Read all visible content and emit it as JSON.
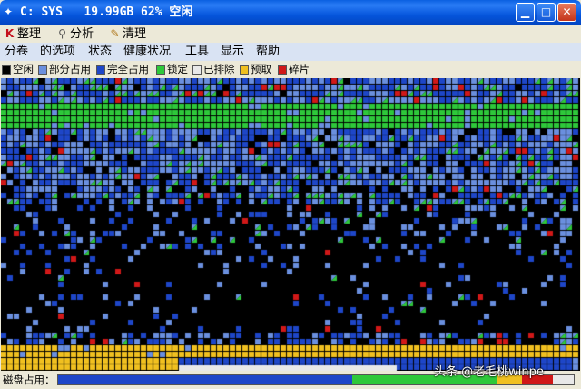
{
  "window": {
    "title": "C: SYS   19.99GB 62% 空闲",
    "controls": {
      "minimize_icon": "minimize-icon",
      "maximize_icon": "maximize-icon",
      "close_icon": "close-icon"
    }
  },
  "toolbar": {
    "defrag_label": "整理",
    "analyze_label": "分析",
    "clean_label": "清理"
  },
  "menu": {
    "items": [
      "分卷",
      "的选项",
      "状态",
      "健康状况",
      "工具",
      "显示",
      "帮助"
    ]
  },
  "legend": {
    "items": [
      {
        "label": "空闲",
        "color": "#000000"
      },
      {
        "label": "部分占用",
        "color": "#6a8fde"
      },
      {
        "label": "完全占用",
        "color": "#1e46c8"
      },
      {
        "label": "锁定",
        "color": "#2ec83a"
      },
      {
        "label": "已排除",
        "color": "#e8e8e8"
      },
      {
        "label": "预取",
        "color": "#f0c020"
      },
      {
        "label": "碎片",
        "color": "#d01818"
      }
    ]
  },
  "status": {
    "usage_label": "磁盘占用：",
    "usage_segments": [
      {
        "color": "#1e46c8",
        "fraction": 0.57
      },
      {
        "color": "#2ec83a",
        "fraction": 0.28
      },
      {
        "color": "#f0c020",
        "fraction": 0.05
      },
      {
        "color": "#d01818",
        "fraction": 0.06
      },
      {
        "color": "#e8e8e8",
        "fraction": 0.04
      }
    ]
  },
  "watermark": "头条 @老毛桃winpe",
  "colors": {
    "free": "#000000",
    "partial": "#6a8fde",
    "full": "#1e46c8",
    "locked": "#2ec83a",
    "excluded": "#e8e8e8",
    "prefetch": "#f0c020",
    "fragment": "#d01818"
  }
}
